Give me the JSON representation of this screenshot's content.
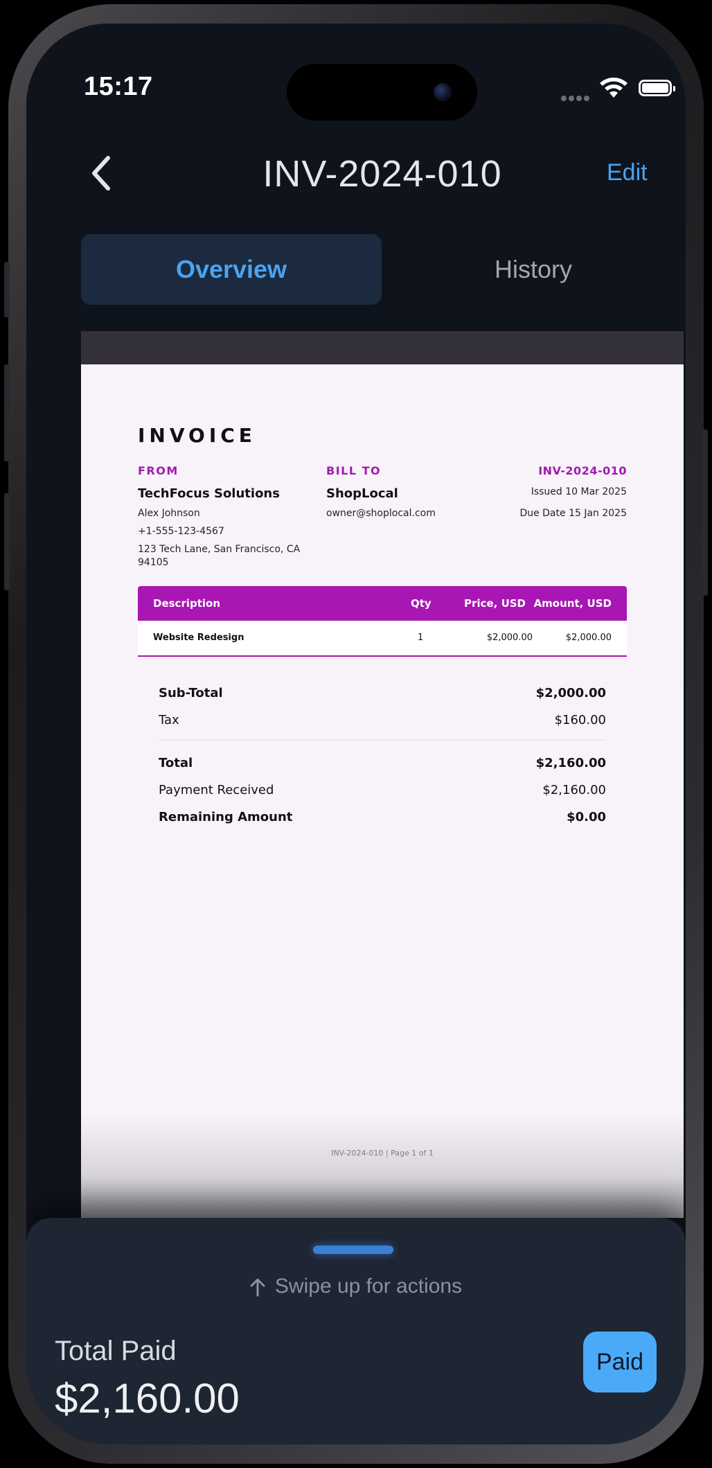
{
  "status_bar": {
    "time": "15:17"
  },
  "nav": {
    "title": "INV-2024-010",
    "edit_label": "Edit"
  },
  "tabs": [
    {
      "label": "Overview",
      "active": true
    },
    {
      "label": "History",
      "active": false
    }
  ],
  "invoice": {
    "heading": "INVOICE",
    "from_label": "FROM",
    "from_name": "TechFocus Solutions",
    "from_contact": "Alex Johnson",
    "from_phone": "+1-555-123-4567",
    "from_address_1": "123 Tech Lane, San Francisco, CA",
    "from_address_2": "94105",
    "bill_to_label": "BILL TO",
    "bill_to_name": "ShopLocal",
    "bill_to_email": "owner@shoplocal.com",
    "number": "INV-2024-010",
    "issued": "Issued 10 Mar 2025",
    "due": "Due Date 15 Jan 2025",
    "table": {
      "headers": [
        "Description",
        "Qty",
        "Price, USD",
        "Amount, USD"
      ],
      "rows": [
        {
          "description": "Website Redesign",
          "qty": "1",
          "price": "$2,000.00",
          "amount": "$2,000.00"
        }
      ]
    },
    "totals": {
      "subtotal_label": "Sub-Total",
      "subtotal": "$2,000.00",
      "tax_label": "Tax",
      "tax": "$160.00",
      "total_label": "Total",
      "total": "$2,160.00",
      "payment_label": "Payment Received",
      "payment": "$2,160.00",
      "remaining_label": "Remaining Amount",
      "remaining": "$0.00"
    },
    "footer": "INV-2024-010 | Page 1 of 1"
  },
  "sheet": {
    "swipe_hint": "Swipe up for actions",
    "total_paid_label": "Total Paid",
    "total_paid_value": "$2,160.00",
    "status_button": "Paid"
  },
  "colors": {
    "accent": "#4aa3f0",
    "invoice_purple": "#a816b4",
    "background": "#0f131c"
  }
}
